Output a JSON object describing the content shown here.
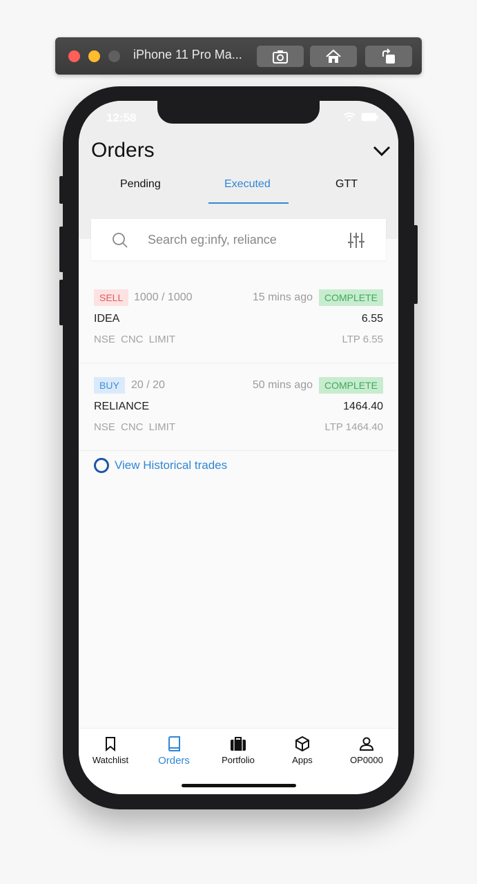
{
  "simulator": {
    "title": "iPhone 11 Pro Ma...",
    "buttons": [
      "screenshot-icon",
      "home-icon",
      "rotate-icon"
    ]
  },
  "status_bar": {
    "time": "12:58"
  },
  "header": {
    "title": "Orders",
    "tabs": [
      {
        "label": "Pending",
        "active": false
      },
      {
        "label": "Executed",
        "active": true
      },
      {
        "label": "GTT",
        "active": false
      }
    ]
  },
  "search": {
    "placeholder": "Search eg:infy, reliance",
    "value": ""
  },
  "orders": [
    {
      "side": "SELL",
      "qty": "1000 / 1000",
      "time_ago": "15 mins ago",
      "status": "COMPLETE",
      "symbol": "IDEA",
      "price": "6.55",
      "meta": "NSE  CNC  LIMIT",
      "ltp": "LTP 6.55"
    },
    {
      "side": "BUY",
      "qty": "20 / 20",
      "time_ago": "50 mins ago",
      "status": "COMPLETE",
      "symbol": "RELIANCE",
      "price": "1464.40",
      "meta": "NSE  CNC  LIMIT",
      "ltp": "LTP 1464.40"
    }
  ],
  "historical_link": "View Historical trades",
  "bottom_nav": [
    {
      "label": "Watchlist",
      "icon": "bookmark-icon",
      "active": false
    },
    {
      "label": "Orders",
      "icon": "book-icon",
      "active": true
    },
    {
      "label": "Portfolio",
      "icon": "briefcase-icon",
      "active": false
    },
    {
      "label": "Apps",
      "icon": "cube-icon",
      "active": false
    },
    {
      "label": "OP0000",
      "icon": "user-icon",
      "active": false
    }
  ],
  "colors": {
    "accent": "#2f86d6",
    "sell": "#e05a5a",
    "buy": "#3a8fd8",
    "complete": "#3faa59"
  }
}
